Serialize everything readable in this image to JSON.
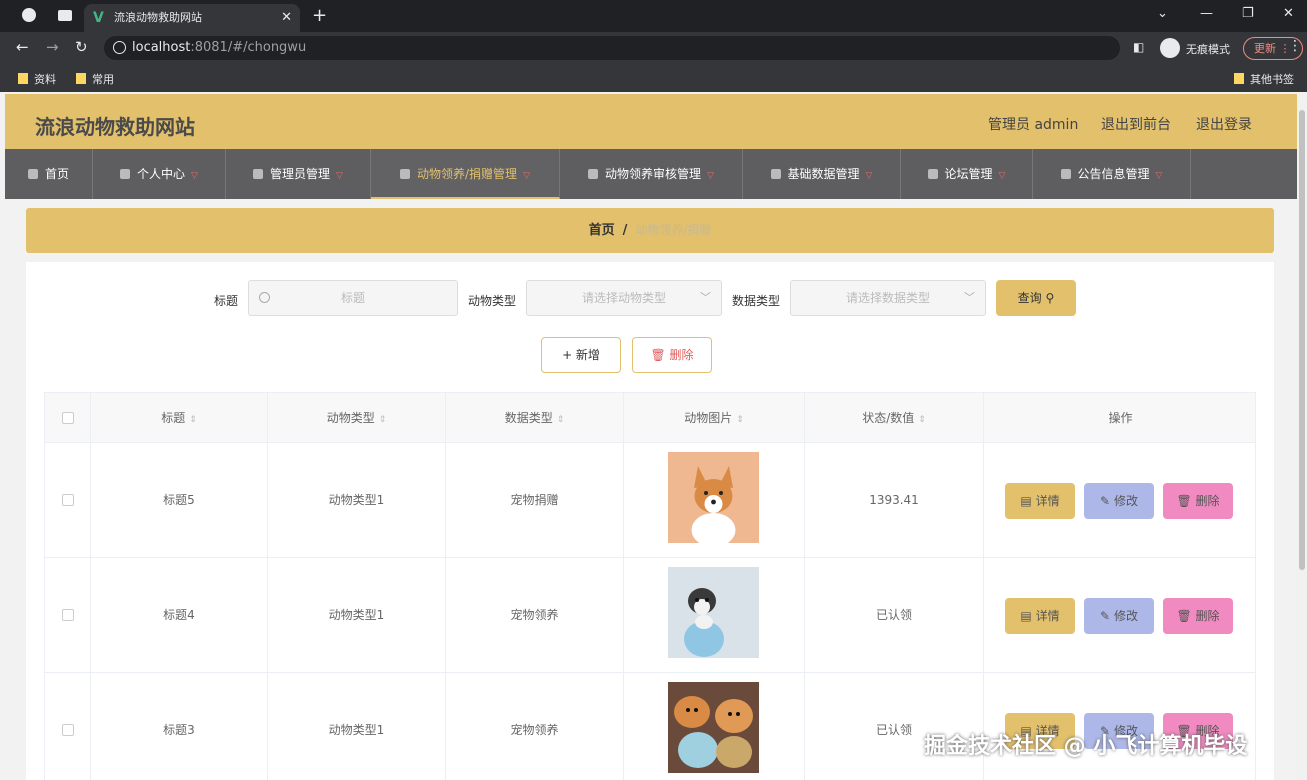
{
  "browser": {
    "tab_title": "流浪动物救助网站",
    "url_host": "localhost",
    "url_rest": ":8081/#/chongwu",
    "incognito_label": "无痕模式",
    "update_label": "更新",
    "bookmarks": [
      "资料",
      "常用"
    ],
    "other_bookmarks": "其他书签"
  },
  "header": {
    "site_title": "流浪动物救助网站",
    "admin_label": "管理员 admin",
    "to_front": "退出到前台",
    "logout": "退出登录"
  },
  "menu": {
    "items": [
      {
        "label": "首页"
      },
      {
        "label": "个人中心"
      },
      {
        "label": "管理员管理"
      },
      {
        "label": "动物领养/捐赠管理"
      },
      {
        "label": "动物领养审核管理"
      },
      {
        "label": "基础数据管理"
      },
      {
        "label": "论坛管理"
      },
      {
        "label": "公告信息管理"
      }
    ]
  },
  "breadcrumb": {
    "home": "首页",
    "sep": "/",
    "current": "动物领养/捐赠"
  },
  "search": {
    "title_label": "标题",
    "title_placeholder": "标题",
    "type_label": "动物类型",
    "type_placeholder": "请选择动物类型",
    "datatype_label": "数据类型",
    "datatype_placeholder": "请选择数据类型",
    "query_label": "查询"
  },
  "actions": {
    "add_label": "+ 新增",
    "delete_label": "删除"
  },
  "table": {
    "headers": [
      "标题",
      "动物类型",
      "数据类型",
      "动物图片",
      "状态/数值",
      "操作"
    ],
    "rows": [
      {
        "title": "标题5",
        "animal_type": "动物类型1",
        "data_type": "宠物捐赠",
        "status": "1393.41"
      },
      {
        "title": "标题4",
        "animal_type": "动物类型1",
        "data_type": "宠物领养",
        "status": "已认领"
      },
      {
        "title": "标题3",
        "animal_type": "动物类型1",
        "data_type": "宠物领养",
        "status": "已认领"
      }
    ],
    "row_actions": {
      "detail": "详情",
      "edit": "修改",
      "delete": "删除"
    }
  },
  "watermark": "掘金技术社区 @ 小飞计算机毕设"
}
